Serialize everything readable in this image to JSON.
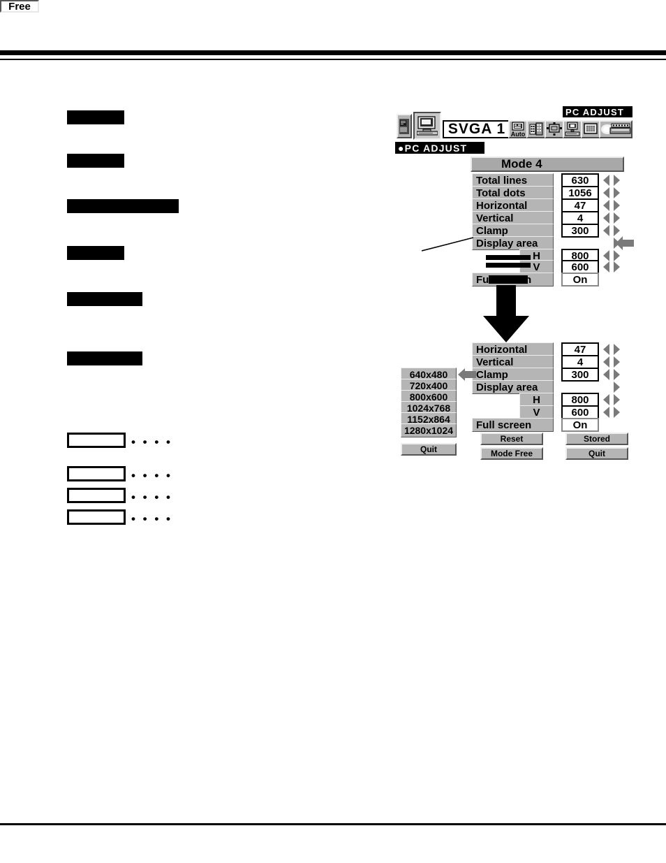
{
  "page": {
    "rules": {
      "top_thick": true,
      "top_thin": true,
      "bottom": true
    }
  },
  "left_column": {
    "redacted_headings": [
      {
        "name": "heading-bar-1"
      },
      {
        "name": "heading-bar-2"
      },
      {
        "name": "heading-bar-3"
      },
      {
        "name": "heading-bar-4"
      },
      {
        "name": "heading-bar-5"
      },
      {
        "name": "heading-bar-6"
      }
    ],
    "key_boxes": [
      {
        "name": "key-box-1",
        "dots": "• • • •"
      },
      {
        "name": "key-box-2",
        "dots": "• • • •"
      },
      {
        "name": "key-box-3",
        "dots": "• • • •"
      },
      {
        "name": "key-box-4",
        "dots": "• • • •"
      }
    ]
  },
  "osd": {
    "menu_bar": {
      "source_value": "SVGA 1",
      "title_badge": "PC ADJUST",
      "menu_label": "●PC ADJUST",
      "icons": [
        {
          "name": "input-source-icon"
        },
        {
          "name": "computer-monitor-icon"
        },
        {
          "name": "auto-pc-adjust-icon",
          "label": "Auto"
        },
        {
          "name": "image-select-icon"
        },
        {
          "name": "image-adjust-icon"
        },
        {
          "name": "screen-size-icon"
        },
        {
          "name": "setting-icon"
        },
        {
          "name": "projector-lamp-icon"
        }
      ]
    },
    "top_dialog": {
      "header": {
        "mode": "Mode 4",
        "free_button": "Free"
      },
      "rows": [
        {
          "label": "Total lines",
          "value": "630",
          "spinner": true
        },
        {
          "label": "Total dots",
          "value": "1056",
          "spinner": true
        },
        {
          "label": "Horizontal",
          "value": "47",
          "spinner": true
        },
        {
          "label": "Vertical",
          "value": "4",
          "spinner": true
        },
        {
          "label": "Clamp",
          "value": "300",
          "spinner": true
        },
        {
          "label": "Display area",
          "value": "",
          "spinner": "right-only"
        },
        {
          "label": "H",
          "value": "800",
          "spinner": true
        },
        {
          "label": "V",
          "value": "600",
          "spinner": true
        },
        {
          "label": "Full screen",
          "value": "On",
          "spinner": false
        }
      ]
    },
    "bottom_dialog": {
      "rows": [
        {
          "label": "Horizontal",
          "value": "47",
          "spinner": true
        },
        {
          "label": "Vertical",
          "value": "4",
          "spinner": true
        },
        {
          "label": "Clamp",
          "value": "300",
          "spinner": true
        },
        {
          "label": "Display area",
          "value": "",
          "spinner": "right-only"
        },
        {
          "label": "H",
          "value": "800",
          "spinner": true
        },
        {
          "label": "V",
          "value": "600",
          "spinner": true
        },
        {
          "label": "Full screen",
          "value": "On",
          "spinner": false
        }
      ],
      "buttons": {
        "reset": "Reset",
        "mode_free": "Mode Free",
        "stored": "Stored",
        "quit": "Quit"
      }
    },
    "resolution_list": {
      "items": [
        "640x480",
        "720x400",
        "800x600",
        "1024x768",
        "1152x864",
        "1280x1024"
      ],
      "selected": "640x480",
      "quit": "Quit"
    }
  },
  "colors": {
    "osd_gray": "#b5b5b5",
    "osd_header_gray": "#a8a8a8",
    "osd_white": "#ffffff",
    "osd_black": "#000000",
    "spinner_gray": "#7a7a7a"
  }
}
